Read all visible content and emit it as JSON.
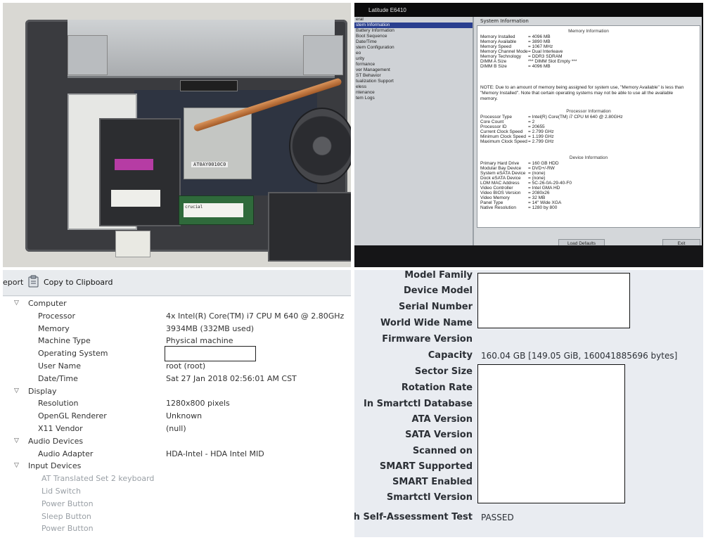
{
  "photo": {
    "hdd_sticker": "",
    "heatsink_label": "AT0AY0010C0",
    "ram_label": "crucial"
  },
  "bios": {
    "title": "Latitude E6410",
    "nav": [
      "eral",
      "stem Information",
      "Battery Information",
      "Boot Sequence",
      "Date/Time",
      "stem Configuration",
      "eo",
      "urity",
      "formance",
      "ver Management",
      "ST Behavior",
      "tualization Support",
      "eless",
      "ntenance",
      "tem Logs"
    ],
    "nav_selected": 1,
    "panel_title": "System Information",
    "memory_header": "Memory Information",
    "memory": [
      {
        "k": "Memory Installed",
        "v": "= 4096 MB"
      },
      {
        "k": "Memory Available",
        "v": "= 3890 MB"
      },
      {
        "k": "Memory Speed",
        "v": "= 1067 MHz"
      },
      {
        "k": "Memory Channel Mode",
        "v": "= Dual Interleave"
      },
      {
        "k": "Memory Technology",
        "v": "= DDR3 SDRAM"
      },
      {
        "k": "DIMM A Size",
        "v": "*** DIMM Slot Empty ***"
      },
      {
        "k": "DIMM B Size",
        "v": "= 4096 MB"
      }
    ],
    "note": "NOTE: Due to an amount of memory being assigned for system use, \"Memory Available\" is less than \"Memory Installed\". Note that certain operating systems may not be able to use all the available memory.",
    "processor_header": "Processor Information",
    "processor": [
      {
        "k": "Processor Type",
        "v": "= Intel(R) Core(TM) i7 CPU      M 640  @ 2.80GHz"
      },
      {
        "k": "Core Count",
        "v": "= 2"
      },
      {
        "k": "Processor ID",
        "v": "= 20655"
      },
      {
        "k": "Current Clock Speed",
        "v": "= 2.799 GHz"
      },
      {
        "k": "Minimum Clock Speed",
        "v": "= 1.199 GHz"
      },
      {
        "k": "Maximum Clock Speed",
        "v": "= 2.799 GHz"
      }
    ],
    "device_header": "Device Information",
    "device": [
      {
        "k": "Primary Hard Drive",
        "v": "= 160 GB HDD"
      },
      {
        "k": "Modular Bay Device",
        "v": "= DVD+/-RW"
      },
      {
        "k": "System eSATA Device",
        "v": "= (none)"
      },
      {
        "k": "Dock eSATA Device",
        "v": "= (none)"
      },
      {
        "k": "LOM MAC Address",
        "v": "= 5C-26-0A-29-40-F0"
      },
      {
        "k": "Video Controller",
        "v": "= Intel GMA HD"
      },
      {
        "k": "Video BIOS Version",
        "v": "= 2080x26"
      },
      {
        "k": "Video Memory",
        "v": "= 32 MB"
      },
      {
        "k": "Panel Type",
        "v": "= 14\" Wide XGA"
      },
      {
        "k": "Native Resolution",
        "v": "= 1280 by 800"
      }
    ],
    "load_defaults": "Load Defaults",
    "exit": "Exit"
  },
  "sysinfo": {
    "report_label": "eport",
    "copy_label": "Copy to Clipboard",
    "rows": [
      {
        "type": "group",
        "label": "Computer"
      },
      {
        "type": "item",
        "label": "Processor",
        "value": "4x Intel(R) Core(TM) i7 CPU      M 640  @ 2.80GHz"
      },
      {
        "type": "item",
        "label": "Memory",
        "value": "3934MB (332MB used)"
      },
      {
        "type": "item",
        "label": "Machine Type",
        "value": "Physical machine"
      },
      {
        "type": "item",
        "label": "Operating System",
        "value": ""
      },
      {
        "type": "item",
        "label": "User Name",
        "value": "root (root)"
      },
      {
        "type": "item",
        "label": "Date/Time",
        "value": "Sat 27 Jan 2018 02:56:01 AM CST"
      },
      {
        "type": "group",
        "label": "Display"
      },
      {
        "type": "item",
        "label": "Resolution",
        "value": "1280x800 pixels"
      },
      {
        "type": "item",
        "label": "OpenGL Renderer",
        "value": "Unknown"
      },
      {
        "type": "item",
        "label": "X11 Vendor",
        "value": "(null)"
      },
      {
        "type": "group",
        "label": "Audio Devices"
      },
      {
        "type": "item",
        "label": "Audio Adapter",
        "value": "HDA-Intel - HDA Intel MID"
      },
      {
        "type": "group",
        "label": "Input Devices"
      },
      {
        "type": "dim",
        "label": "AT Translated Set 2 keyboard",
        "value": ""
      },
      {
        "type": "dim",
        "label": "Lid Switch",
        "value": ""
      },
      {
        "type": "dim",
        "label": "Power Button",
        "value": ""
      },
      {
        "type": "dim",
        "label": "Sleep Button",
        "value": ""
      },
      {
        "type": "dim",
        "label": "Power Button",
        "value": ""
      }
    ]
  },
  "smart": {
    "rows": [
      {
        "label": "Model Family",
        "value": ""
      },
      {
        "label": "Device Model",
        "value": ""
      },
      {
        "label": "Serial Number",
        "value": ""
      },
      {
        "label": "World Wide Name",
        "value": ""
      },
      {
        "label": "Firmware Version",
        "value": ""
      },
      {
        "label": "Capacity",
        "value": "160.04 GB [149.05 GiB, 160041885696 bytes]"
      },
      {
        "label": "Sector Size",
        "value": ""
      },
      {
        "label": "Rotation Rate",
        "value": ""
      },
      {
        "label": "In Smartctl Database",
        "value": ""
      },
      {
        "label": "ATA Version",
        "value": ""
      },
      {
        "label": "SATA Version",
        "value": ""
      },
      {
        "label": "Scanned on",
        "value": ""
      },
      {
        "label": "SMART Supported",
        "value": ""
      },
      {
        "label": "SMART Enabled",
        "value": ""
      },
      {
        "label": "Smartctl Version",
        "value": ""
      },
      {
        "label": "alth Self-Assessment Test",
        "value": "PASSED"
      }
    ]
  }
}
